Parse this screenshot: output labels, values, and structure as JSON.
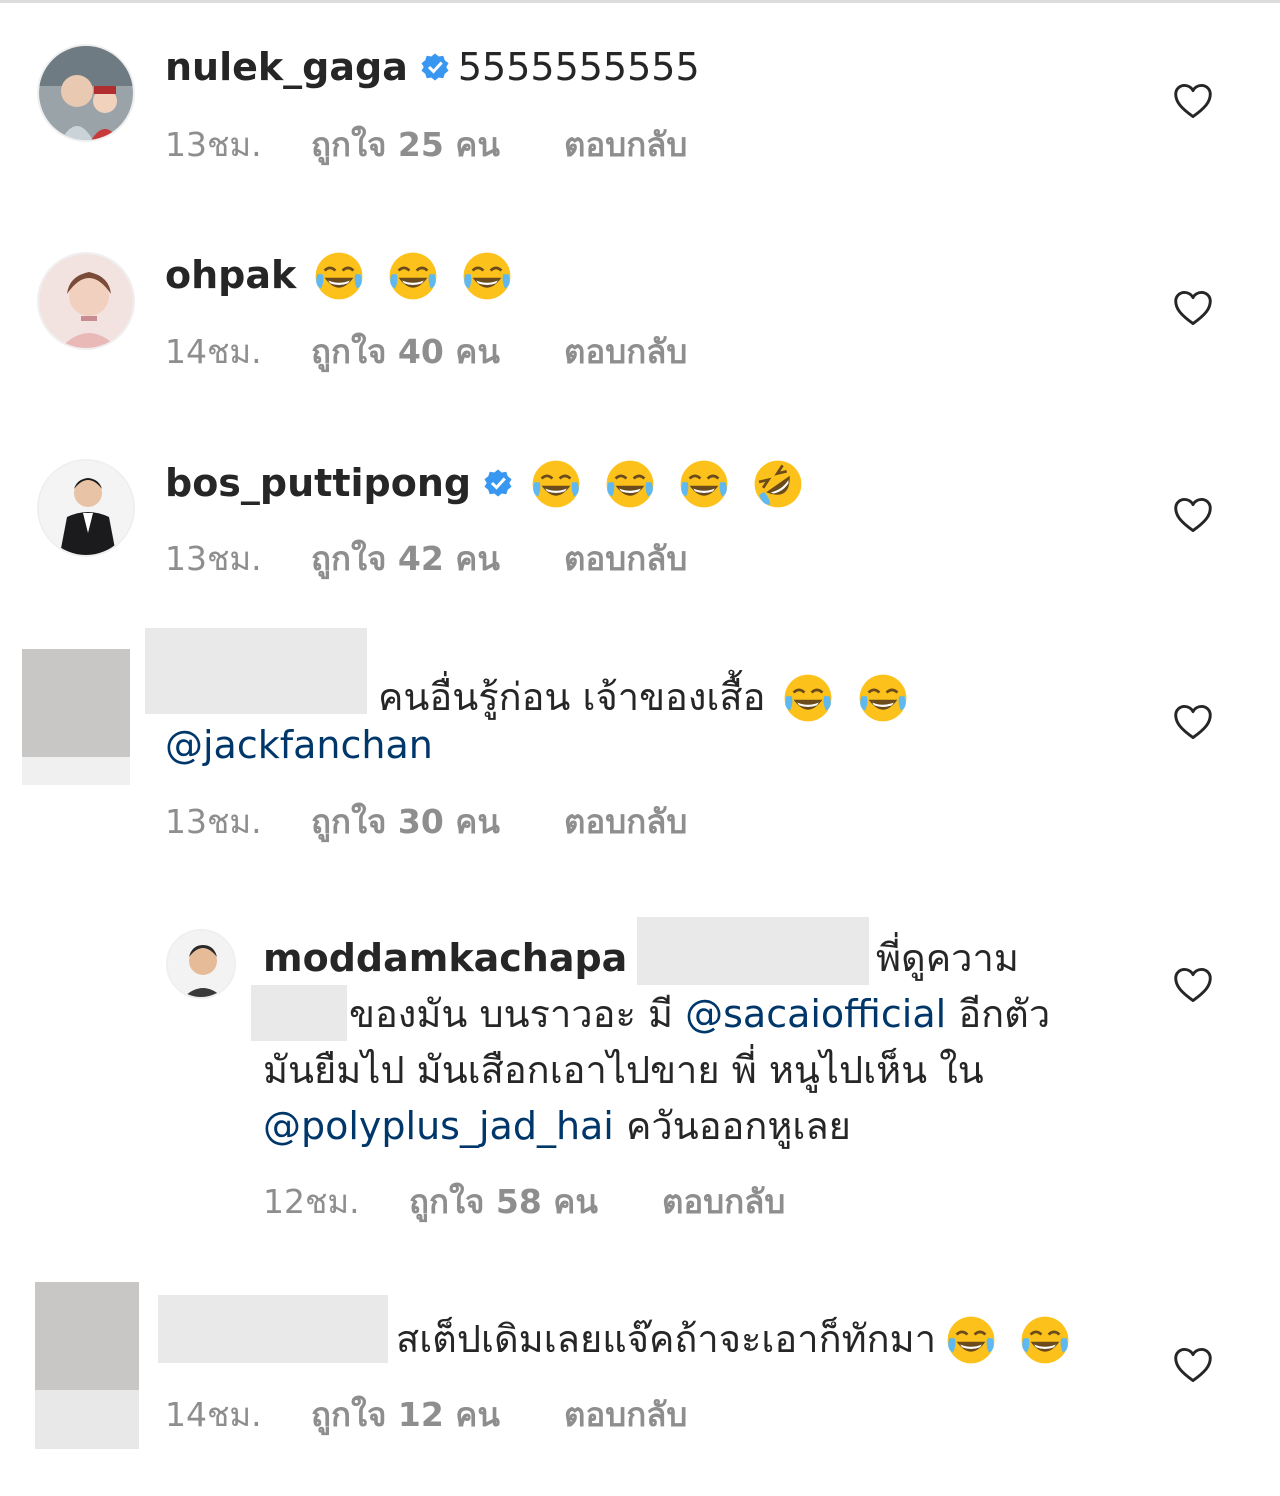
{
  "comments": [
    {
      "username": "nulek_gaga",
      "verified": true,
      "text": "5555555555",
      "time": "13ชม.",
      "likes": "ถูกใจ 25 คน",
      "reply": "ตอบกลับ"
    },
    {
      "username": "ohpak",
      "verified": false,
      "emojis": [
        "face-with-tears-of-joy",
        "face-with-tears-of-joy",
        "face-with-tears-of-joy"
      ],
      "time": "14ชม.",
      "likes": "ถูกใจ 40 คน",
      "reply": "ตอบกลับ"
    },
    {
      "username": "bos_puttipong",
      "verified": true,
      "emojis": [
        "face-with-tears-of-joy",
        "face-with-tears-of-joy",
        "face-with-tears-of-joy",
        "rolling-on-floor-laughing"
      ],
      "time": "13ชม.",
      "likes": "ถูกใจ 42 คน",
      "reply": "ตอบกลับ"
    },
    {
      "username": "",
      "text": "คนอื่นรู้ก่อน เจ้าของเสื้อ",
      "mention": "@jackfanchan",
      "emojis": [
        "face-with-tears-of-joy",
        "face-with-tears-of-joy"
      ],
      "time": "13ชม.",
      "likes": "ถูกใจ 30 คน",
      "reply": "ตอบกลับ"
    },
    {
      "username": "moddamkachapa",
      "is_reply": true,
      "text_part1": "พี่ดูความ",
      "text_part2": "ของมัน บนราวอะ มี",
      "mention1": "@sacaiofficial",
      "text_part3": "อีกตัว",
      "text_part4": "มันยืมไป มันเสือกเอาไปขาย พี่ หนูไปเห็น ใน",
      "mention2": "@polyplus_jad_hai",
      "text_part5": "ควันออกหูเลย",
      "time": "12ชม.",
      "likes": "ถูกใจ 58 คน",
      "reply": "ตอบกลับ"
    },
    {
      "username": "",
      "text": "สเต็ปเดิมเลยแจ๊คถ้าจะเอาก็ทักมา",
      "emojis": [
        "face-with-tears-of-joy",
        "face-with-tears-of-joy"
      ],
      "time": "14ชม.",
      "likes": "ถูกใจ 12 คน",
      "reply": "ตอบกลับ"
    }
  ],
  "colors": {
    "text": "#262626",
    "meta": "#8e8e8e",
    "mention": "#00376b",
    "verified": "#3897f0"
  }
}
